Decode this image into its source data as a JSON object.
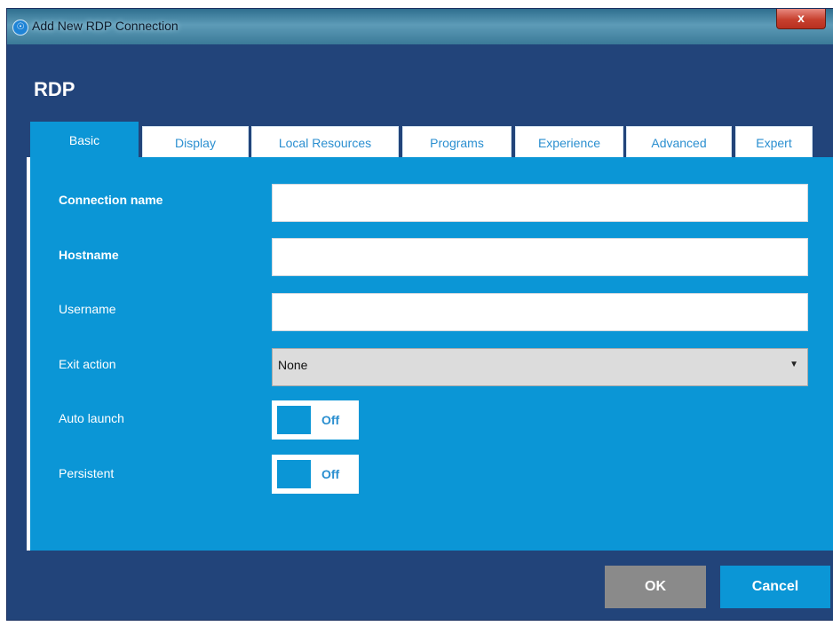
{
  "window": {
    "title": "Add New RDP Connection",
    "close_label": "x"
  },
  "heading": "RDP",
  "tabs": [
    {
      "label": "Basic",
      "active": true
    },
    {
      "label": "Display",
      "active": false
    },
    {
      "label": "Local Resources",
      "active": false
    },
    {
      "label": "Programs",
      "active": false
    },
    {
      "label": "Experience",
      "active": false
    },
    {
      "label": "Advanced",
      "active": false
    },
    {
      "label": "Expert",
      "active": false
    }
  ],
  "form": {
    "connection_name": {
      "label": "Connection name",
      "value": ""
    },
    "hostname": {
      "label": "Hostname",
      "value": ""
    },
    "username": {
      "label": "Username",
      "value": ""
    },
    "exit_action": {
      "label": "Exit action",
      "value": "None"
    },
    "auto_launch": {
      "label": "Auto launch",
      "state": "Off"
    },
    "persistent": {
      "label": "Persistent",
      "state": "Off"
    }
  },
  "buttons": {
    "ok": "OK",
    "cancel": "Cancel"
  },
  "colors": {
    "window_bg": "#22447a",
    "panel_accent": "#0b96d6",
    "ok_button": "#8a8a8a"
  }
}
